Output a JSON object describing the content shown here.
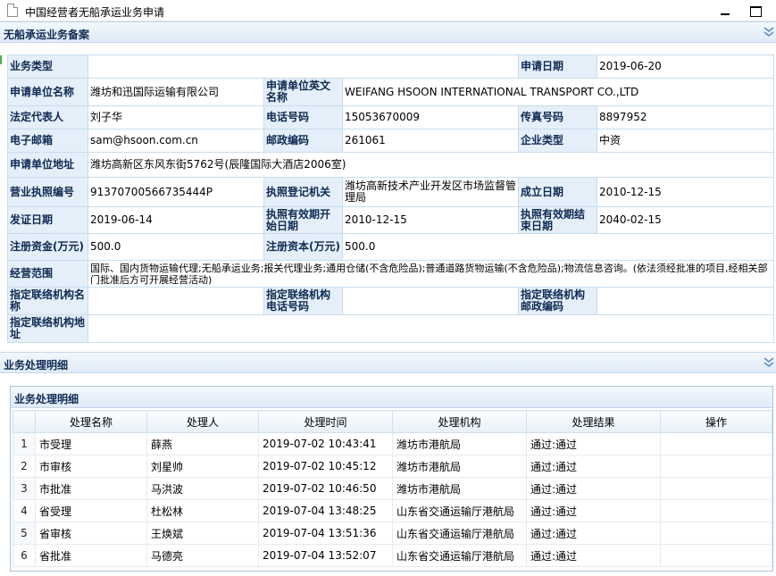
{
  "window": {
    "title": "中国经营者无船承运业务申请"
  },
  "section1": {
    "title": "无船承运业务备案"
  },
  "record": {
    "labels": {
      "business_type": "业务类型",
      "apply_date": "申请日期",
      "company_name": "申请单位名称",
      "company_name_en": "申请单位英文名称",
      "legal_rep": "法定代表人",
      "phone": "电话号码",
      "fax": "传真号码",
      "email": "电子邮箱",
      "postcode": "邮政编码",
      "enterprise_type": "企业类型",
      "address": "申请单位地址",
      "license_no": "营业执照编号",
      "license_authority": "执照登记机关",
      "established": "成立日期",
      "issue_date": "发证日期",
      "valid_start": "执照有效期开始日期",
      "valid_end": "执照有效期结束日期",
      "registered_capital_1": "注册资金(万元)",
      "registered_capital_2": "注册资本(万元)",
      "scope": "经营范围",
      "contact_name": "指定联络机构名称",
      "contact_phone": "指定联络机构电话号码",
      "contact_postcode": "指定联络机构邮政编码",
      "contact_address": "指定联络机构地址"
    },
    "values": {
      "business_type": "",
      "apply_date": "2019-06-20",
      "company_name": "潍坊和迅国际运输有限公司",
      "company_name_en": "WEIFANG HSOON INTERNATIONAL TRANSPORT CO.,LTD",
      "legal_rep": "刘子华",
      "phone": "15053670009",
      "fax": "8897952",
      "email": "sam@hsoon.com.cn",
      "postcode": "261061",
      "enterprise_type": "中资",
      "address": "潍坊高新区东风东街5762号(辰隆国际大酒店2006室)",
      "license_no": "91370700566735444P",
      "license_authority": "潍坊高新技术产业开发区市场监督管理局",
      "established": "2010-12-15",
      "issue_date": "2019-06-14",
      "valid_start": "2010-12-15",
      "valid_end": "2040-02-15",
      "registered_capital_1": "500.0",
      "registered_capital_2": "500.0",
      "scope": "国际、国内货物运输代理;无船承运业务;报关代理业务;通用仓储(不含危险品);普通道路货物运输(不含危险品);物流信息咨询。(依法须经批准的项目,经相关部门批准后方可开展经营活动)",
      "contact_name": "",
      "contact_phone": "",
      "contact_postcode": "",
      "contact_address": ""
    }
  },
  "section2": {
    "title": "业务处理明细"
  },
  "panel": {
    "title": "业务处理明细",
    "columns": [
      "",
      "处理名称",
      "处理人",
      "处理时间",
      "处理机构",
      "处理结果",
      "操作"
    ],
    "rows": [
      {
        "no": "1",
        "name": "市受理",
        "person": "薛燕",
        "time": "2019-07-02 10:43:41",
        "org": "潍坊市港航局",
        "result": "通过:通过",
        "op": ""
      },
      {
        "no": "2",
        "name": "市审核",
        "person": "刘星帅",
        "time": "2019-07-02 10:45:12",
        "org": "潍坊市港航局",
        "result": "通过:通过",
        "op": ""
      },
      {
        "no": "3",
        "name": "市批准",
        "person": "马洪波",
        "time": "2019-07-02 10:46:50",
        "org": "潍坊市港航局",
        "result": "通过:通过",
        "op": ""
      },
      {
        "no": "4",
        "name": "省受理",
        "person": "杜松林",
        "time": "2019-07-04 13:48:25",
        "org": "山东省交通运输厅港航局",
        "result": "通过:通过",
        "op": ""
      },
      {
        "no": "5",
        "name": "省审核",
        "person": "王焕斌",
        "time": "2019-07-04 13:51:36",
        "org": "山东省交通运输厅港航局",
        "result": "通过:通过",
        "op": ""
      },
      {
        "no": "6",
        "name": "省批准",
        "person": "马德亮",
        "time": "2019-07-04 13:52:07",
        "org": "山东省交通运输厅港航局",
        "result": "通过:通过",
        "op": ""
      }
    ]
  }
}
